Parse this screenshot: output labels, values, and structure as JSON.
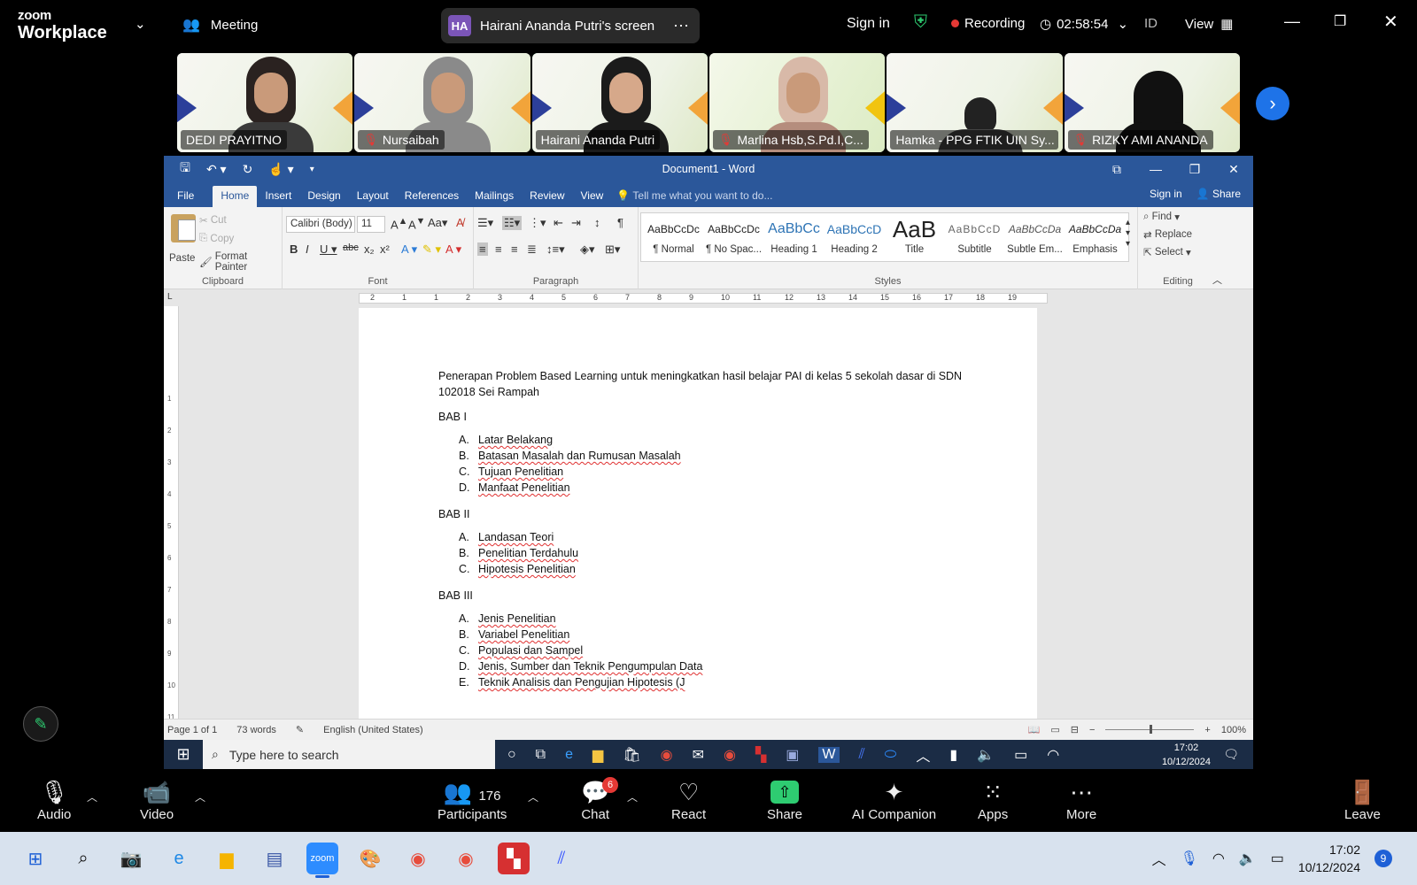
{
  "zoom": {
    "brand_top": "zoom",
    "brand_bottom": "Workplace",
    "meeting_label": "Meeting",
    "share_initials": "HA",
    "share_label": "Hairani Ananda Putri's screen",
    "sign_in": "Sign in",
    "recording": "Recording",
    "timer": "02:58:54",
    "lang": "ID",
    "view": "View"
  },
  "participants": [
    {
      "name": "DEDI PRAYITNO",
      "muted": false
    },
    {
      "name": "Nursaibah",
      "muted": true
    },
    {
      "name": "Hairani Ananda Putri",
      "muted": false,
      "active": true
    },
    {
      "name": "Marlina Hsb,S.Pd.I,C...",
      "muted": true
    },
    {
      "name": "Hamka - PPG FTIK UIN Sy...",
      "muted": false
    },
    {
      "name": "RIZKY AMI ANANDA",
      "muted": true
    }
  ],
  "word": {
    "title": "Document1 - Word",
    "tabs": [
      "File",
      "Home",
      "Insert",
      "Design",
      "Layout",
      "References",
      "Mailings",
      "Review",
      "View"
    ],
    "tell_me": "Tell me what you want to do...",
    "sign_in": "Sign in",
    "share": "Share",
    "clipboard": {
      "paste": "Paste",
      "cut": "Cut",
      "copy": "Copy",
      "format_painter": "Format Painter",
      "label": "Clipboard"
    },
    "font": {
      "name": "Calibri (Body)",
      "size": "11",
      "label": "Font"
    },
    "paragraph_label": "Paragraph",
    "styles": [
      {
        "preview": "AaBbCcDc",
        "label": "¶ Normal"
      },
      {
        "preview": "AaBbCcDc",
        "label": "¶ No Spac..."
      },
      {
        "preview": "AaBbCc",
        "label": "Heading 1"
      },
      {
        "preview": "AaBbCcD",
        "label": "Heading 2"
      },
      {
        "preview": "AaB",
        "label": "Title"
      },
      {
        "preview": "AaBbCcD",
        "label": "Subtitle"
      },
      {
        "preview": "AaBbCcDa",
        "label": "Subtle Em..."
      },
      {
        "preview": "AaBbCcDa",
        "label": "Emphasis"
      }
    ],
    "styles_label": "Styles",
    "editing": {
      "find": "Find",
      "replace": "Replace",
      "select": "Select",
      "label": "Editing"
    },
    "ruler_numbers": [
      "2",
      "1",
      "1",
      "2",
      "3",
      "4",
      "5",
      "6",
      "7",
      "8",
      "9",
      "10",
      "11",
      "12",
      "13",
      "14",
      "15",
      "16",
      "17",
      "18",
      "19"
    ],
    "vruler_numbers": [
      "1",
      "2",
      "3",
      "4",
      "5",
      "6",
      "7",
      "8",
      "9",
      "10",
      "11"
    ],
    "document": {
      "title_line1": "Penerapan Problem Based Learning untuk meningkatkan hasil belajar PAI di kelas 5 sekolah dasar di SDN",
      "title_line2": "102018 Sei Rampah",
      "bab1": "BAB I",
      "bab1_items": [
        [
          "A.",
          "Latar Belakang"
        ],
        [
          "B.",
          "Batasan Masalah dan Rumusan Masalah"
        ],
        [
          "C.",
          "Tujuan Penelitian"
        ],
        [
          "D.",
          "Manfaat Penelitian"
        ]
      ],
      "bab2": "BAB II",
      "bab2_items": [
        [
          "A.",
          "Landasan Teori"
        ],
        [
          "B.",
          "Penelitian Terdahulu"
        ],
        [
          "C.",
          "Hipotesis Penelitian"
        ]
      ],
      "bab3": "BAB III",
      "bab3_items": [
        [
          "A.",
          "Jenis Penelitian"
        ],
        [
          "B.",
          "Variabel Penelitian"
        ],
        [
          "C.",
          "Populasi dan Sampel"
        ],
        [
          "D.",
          "Jenis, Sumber dan Teknik Pengumpulan Data"
        ],
        [
          "E.",
          "Teknik Analisis dan Pengujian Hipotesis (J"
        ]
      ]
    },
    "status": {
      "page": "Page 1 of 1",
      "words": "73 words",
      "language": "English (United States)",
      "zoom": "100%"
    }
  },
  "remote_taskbar": {
    "search": "Type here to search",
    "time": "17:02",
    "date": "10/12/2024"
  },
  "toolbar": {
    "audio": "Audio",
    "video": "Video",
    "participants": "Participants",
    "participants_count": "176",
    "chat": "Chat",
    "chat_badge": "6",
    "react": "React",
    "share": "Share",
    "ai": "AI Companion",
    "apps": "Apps",
    "more": "More",
    "leave": "Leave"
  },
  "windows": {
    "time": "17:02",
    "date": "10/12/2024",
    "notifications": "9"
  }
}
